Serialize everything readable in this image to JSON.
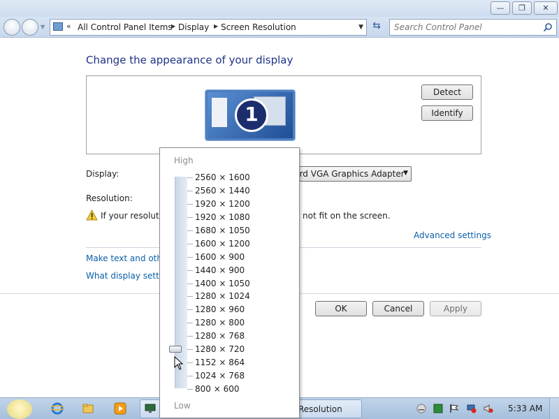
{
  "window": {
    "minimize": "—",
    "maximize": "❐",
    "close": "✕"
  },
  "nav": {
    "chevrons": "«",
    "breadcrumbs": [
      "All Control Panel Items",
      "Display",
      "Screen Resolution"
    ],
    "search_placeholder": "Search Control Panel"
  },
  "main": {
    "title": "Change the appearance of your display",
    "monitor_number": "1",
    "detect_label": "Detect",
    "identify_label": "Identify",
    "display_label": "Display:",
    "display_value": "ndard VGA Graphics Adapter",
    "resolution_label": "Resolution:",
    "warning_prefix": "If your resolutio",
    "warning_suffix": "not fit on the screen.",
    "advanced_settings": "Advanced settings",
    "link_text_size": "Make text and other",
    "link_display_settings": "What display setting",
    "ok_label": "OK",
    "cancel_label": "Cancel",
    "apply_label": "Apply"
  },
  "resolution_popup": {
    "high_label": "High",
    "low_label": "Low",
    "options": [
      "2560 × 1600",
      "2560 × 1440",
      "1920 × 1200",
      "1920 × 1080",
      "1680 × 1050",
      "1600 × 1200",
      "1600 × 900",
      "1440 × 900",
      "1400 × 1050",
      "1280 × 1024",
      "1280 × 960",
      "1280 × 800",
      "1280 × 768",
      "1280 × 720",
      "1152 × 864",
      "1024 × 768",
      "800 × 600"
    ],
    "selected": "1280 × 720"
  },
  "taskbar": {
    "task_label": "Resolution",
    "clock": "5:33 AM"
  },
  "colors": {
    "title": "#1e3287",
    "link": "#0a5fa8",
    "taskbar": "#a6bfdc"
  }
}
